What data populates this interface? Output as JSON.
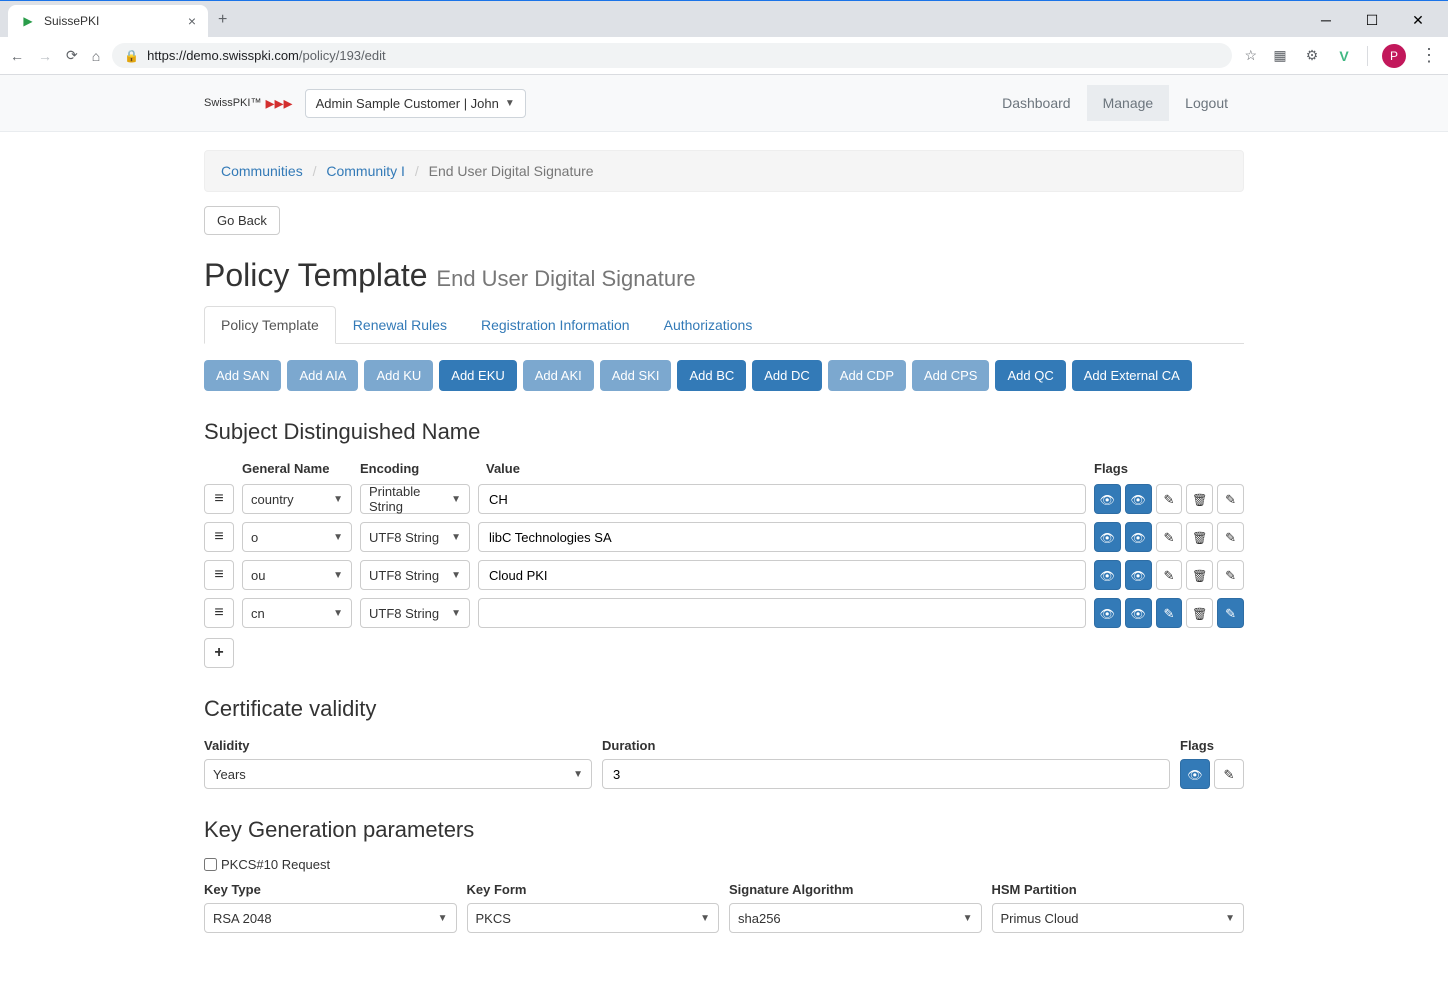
{
  "browser": {
    "tab_title": "SuissePKI",
    "url_protocol": "https://",
    "url_host": "demo.swisspki.com",
    "url_path": "/policy/193/edit",
    "avatar_initial": "P"
  },
  "header": {
    "brand": "SwissPKI™",
    "customer_select": "Admin Sample Customer | John",
    "nav": {
      "dashboard": "Dashboard",
      "manage": "Manage",
      "logout": "Logout"
    }
  },
  "breadcrumb": {
    "communities": "Communities",
    "community": "Community I",
    "current": "End User Digital Signature"
  },
  "goback": "Go Back",
  "page": {
    "title": "Policy Template",
    "subtitle": "End User Digital Signature"
  },
  "tabs": {
    "policy_template": "Policy Template",
    "renewal_rules": "Renewal Rules",
    "registration_info": "Registration Information",
    "authorizations": "Authorizations"
  },
  "add_buttons": {
    "san": "Add SAN",
    "aia": "Add AIA",
    "ku": "Add KU",
    "eku": "Add EKU",
    "aki": "Add AKI",
    "ski": "Add SKI",
    "bc": "Add BC",
    "dc": "Add DC",
    "cdp": "Add CDP",
    "cps": "Add CPS",
    "qc": "Add QC",
    "external_ca": "Add External CA"
  },
  "sdn": {
    "heading": "Subject Distinguished Name",
    "headers": {
      "general_name": "General Name",
      "encoding": "Encoding",
      "value": "Value",
      "flags": "Flags"
    },
    "rows": [
      {
        "gname": "country",
        "encoding": "Printable String",
        "value": "CH",
        "edit_active": false
      },
      {
        "gname": "o",
        "encoding": "UTF8 String",
        "value": "libC Technologies SA",
        "edit_active": false
      },
      {
        "gname": "ou",
        "encoding": "UTF8 String",
        "value": "Cloud PKI",
        "edit_active": false
      },
      {
        "gname": "cn",
        "encoding": "UTF8 String",
        "value": "",
        "edit_active": true
      }
    ]
  },
  "validity": {
    "heading": "Certificate validity",
    "headers": {
      "validity": "Validity",
      "duration": "Duration",
      "flags": "Flags"
    },
    "unit": "Years",
    "duration": "3"
  },
  "keygen": {
    "heading": "Key Generation parameters",
    "pkcs10_label": "PKCS#10 Request",
    "headers": {
      "key_type": "Key Type",
      "key_form": "Key Form",
      "sig_alg": "Signature Algorithm",
      "hsm": "HSM Partition"
    },
    "key_type": "RSA 2048",
    "key_form": "PKCS",
    "sig_alg": "sha256",
    "hsm": "Primus Cloud"
  }
}
